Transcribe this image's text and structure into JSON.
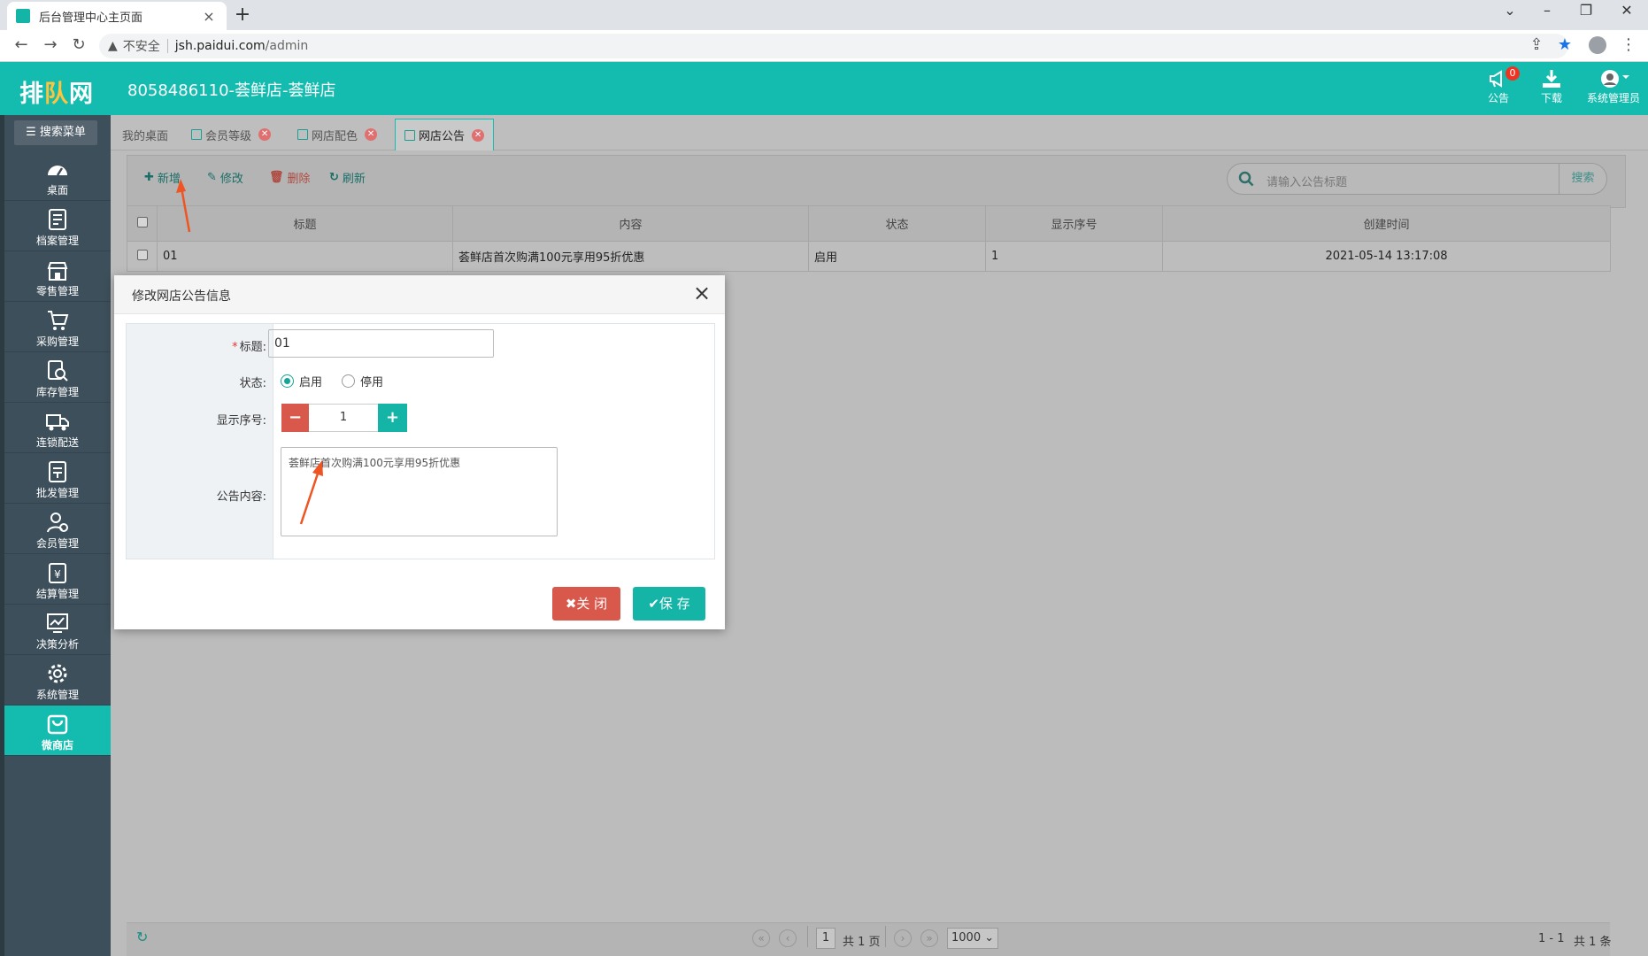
{
  "browser": {
    "tab_title": "后台管理中心主页面",
    "tab_close": "×",
    "new_tab": "+",
    "not_secure": "不安全",
    "url_host": "jsh.paidui.com",
    "url_path": "/admin"
  },
  "app": {
    "logo_a": "排",
    "logo_b": "队",
    "logo_c": "网",
    "shop_name": "8058486110-荟鲜店-荟鲜店",
    "announce_label": "公告",
    "announce_count": "0",
    "download_label": "下载",
    "user_label": "系统管理员"
  },
  "sidebar": {
    "search_menu": "搜索菜单",
    "items": [
      {
        "label": "桌面",
        "icon": "dashboard-icon"
      },
      {
        "label": "档案管理",
        "icon": "archive-icon"
      },
      {
        "label": "零售管理",
        "icon": "store-icon"
      },
      {
        "label": "采购管理",
        "icon": "cart-icon"
      },
      {
        "label": "库存管理",
        "icon": "inventory-search-icon"
      },
      {
        "label": "连锁配送",
        "icon": "truck-icon"
      },
      {
        "label": "批发管理",
        "icon": "wholesale-icon"
      },
      {
        "label": "会员管理",
        "icon": "member-icon"
      },
      {
        "label": "结算管理",
        "icon": "settlement-icon"
      },
      {
        "label": "决策分析",
        "icon": "analytics-icon"
      },
      {
        "label": "系统管理",
        "icon": "gear-icon"
      },
      {
        "label": "微商店",
        "icon": "microshop-icon"
      }
    ]
  },
  "tabs": {
    "home": "我的桌面",
    "t1": "会员等级",
    "t2": "网店配色",
    "t3": "网店公告"
  },
  "toolbar": {
    "add": "新增",
    "edit": "修改",
    "delete": "删除",
    "refresh": "刷新",
    "search_placeholder": "请输入公告标题",
    "search_button": "搜索"
  },
  "table": {
    "headers": [
      "标题",
      "内容",
      "状态",
      "显示序号",
      "创建时间"
    ],
    "rows": [
      {
        "title": "01",
        "content": "荟鲜店首次购满100元享用95折优惠",
        "status": "启用",
        "order": "1",
        "created": "2021-05-14 13:17:08"
      }
    ]
  },
  "pager": {
    "page": "1",
    "total_pages": "共 1 页",
    "page_size": "1000",
    "range": "1 - 1",
    "total": "共 1 条"
  },
  "modal": {
    "title": "修改网店公告信息",
    "close_x": "×",
    "label_title": "标题:",
    "label_status": "状态:",
    "label_order": "显示序号:",
    "label_content": "公告内容:",
    "title_value": "01",
    "status_on": "启用",
    "status_off": "停用",
    "order_value": "1",
    "minus": "−",
    "plus": "+",
    "content_value": "荟鲜店首次购满100元享用95折优惠",
    "btn_close": "关 闭",
    "btn_save": "保 存"
  },
  "colors": {
    "brand": "#14bcb0",
    "danger": "#d9584c",
    "sidebar": "#3d4f5a"
  }
}
